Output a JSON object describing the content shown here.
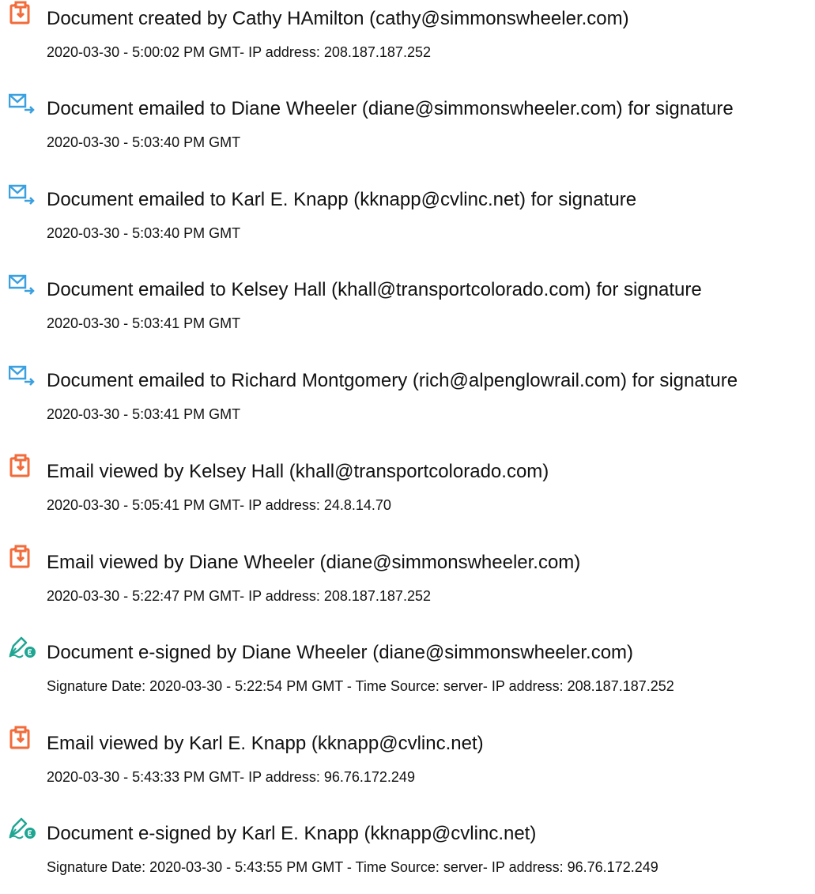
{
  "audit_log": {
    "entries": [
      {
        "icon": "document-orange-icon",
        "title": "Document created by Cathy HAmilton (cathy@simmonswheeler.com)",
        "detail": "2020-03-30 - 5:00:02 PM GMT- IP address: 208.187.187.252"
      },
      {
        "icon": "email-sent-icon",
        "title": "Document emailed to Diane Wheeler (diane@simmonswheeler.com) for signature",
        "detail": "2020-03-30 - 5:03:40 PM GMT"
      },
      {
        "icon": "email-sent-icon",
        "title": "Document emailed to Karl E. Knapp (kknapp@cvlinc.net) for signature",
        "detail": "2020-03-30 - 5:03:40 PM GMT"
      },
      {
        "icon": "email-sent-icon",
        "title": "Document emailed to Kelsey Hall (khall@transportcolorado.com) for signature",
        "detail": "2020-03-30 - 5:03:41 PM GMT"
      },
      {
        "icon": "email-sent-icon",
        "title": "Document emailed to Richard Montgomery (rich@alpenglowrail.com) for signature",
        "detail": "2020-03-30 - 5:03:41 PM GMT"
      },
      {
        "icon": "document-orange-icon",
        "title": "Email viewed by Kelsey Hall (khall@transportcolorado.com)",
        "detail": "2020-03-30 - 5:05:41 PM GMT- IP address: 24.8.14.70"
      },
      {
        "icon": "document-orange-icon",
        "title": "Email viewed by Diane Wheeler (diane@simmonswheeler.com)",
        "detail": "2020-03-30 - 5:22:47 PM GMT- IP address: 208.187.187.252"
      },
      {
        "icon": "esign-pen-icon",
        "title": "Document e-signed by Diane Wheeler (diane@simmonswheeler.com)",
        "detail": "Signature Date: 2020-03-30 - 5:22:54 PM GMT - Time Source: server- IP address: 208.187.187.252"
      },
      {
        "icon": "document-orange-icon",
        "title": "Email viewed by Karl E. Knapp (kknapp@cvlinc.net)",
        "detail": "2020-03-30 - 5:43:33 PM GMT- IP address: 96.76.172.249"
      },
      {
        "icon": "esign-pen-icon",
        "title": "Document e-signed by Karl E. Knapp (kknapp@cvlinc.net)",
        "detail": "Signature Date: 2020-03-30 - 5:43:55 PM GMT - Time Source: server- IP address: 96.76.172.249"
      }
    ]
  },
  "colors": {
    "orange_accent": "#f26b3a",
    "blue_accent": "#3aa0e0",
    "teal_accent": "#1fa693"
  }
}
